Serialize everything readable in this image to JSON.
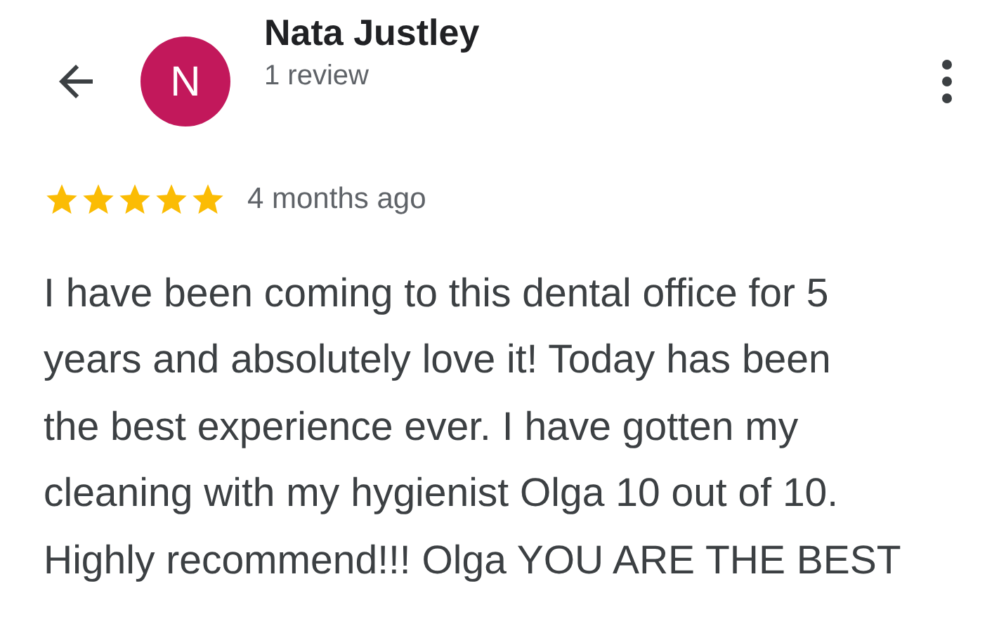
{
  "reviewer": {
    "avatar_letter": "N",
    "name": "Nata Justley",
    "review_count": "1 review"
  },
  "review": {
    "stars": 5,
    "time": "4 months ago",
    "text": "I have been coming to this dental office for 5\nyears and absolutely love it! Today has been\nthe best experience ever. I have gotten my\ncleaning with my hygienist Olga 10 out of 10.\nHighly recommend!!! Olga YOU ARE THE BEST"
  }
}
